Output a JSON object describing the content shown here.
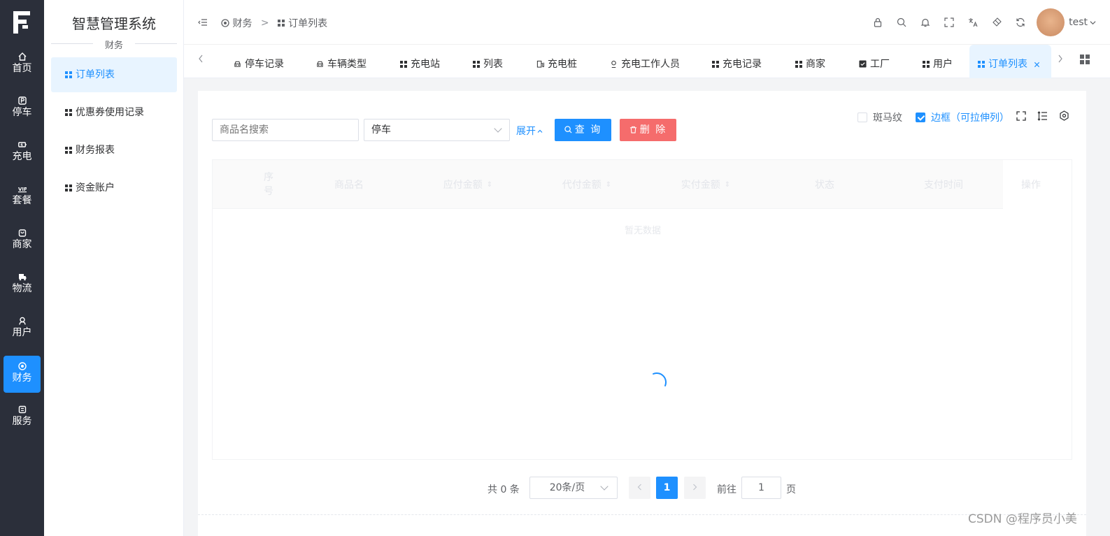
{
  "rail": {
    "items": [
      {
        "label": "首页",
        "icon": "home-icon"
      },
      {
        "label": "停车",
        "icon": "parking-icon"
      },
      {
        "label": "充电",
        "icon": "battery-icon"
      },
      {
        "label": "套餐",
        "icon": "vip-icon"
      },
      {
        "label": "商家",
        "icon": "shop-icon"
      },
      {
        "label": "物流",
        "icon": "truck-icon"
      },
      {
        "label": "用户",
        "icon": "user-icon"
      },
      {
        "label": "财务",
        "icon": "finance-icon",
        "active": true
      },
      {
        "label": "服务",
        "icon": "service-icon"
      }
    ]
  },
  "submenu": {
    "title": "智慧管理系统",
    "group": "财务",
    "items": [
      {
        "label": "订单列表",
        "active": true
      },
      {
        "label": "优惠券使用记录"
      },
      {
        "label": "财务报表"
      },
      {
        "label": "资金账户"
      }
    ]
  },
  "header": {
    "breadcrumb": [
      "财务",
      ">",
      "订单列表"
    ],
    "user": "test"
  },
  "tabs": [
    {
      "label": "停车记录",
      "icon": "car-icon"
    },
    {
      "label": "车辆类型",
      "icon": "car-icon"
    },
    {
      "label": "充电站",
      "icon": "grid-icon"
    },
    {
      "label": "列表",
      "icon": "grid-icon"
    },
    {
      "label": "充电桩",
      "icon": "charger-icon"
    },
    {
      "label": "充电工作人员",
      "icon": "worker-icon"
    },
    {
      "label": "充电记录",
      "icon": "grid-icon"
    },
    {
      "label": "商家",
      "icon": "grid-icon"
    },
    {
      "label": "工厂",
      "icon": "factory-icon"
    },
    {
      "label": "用户",
      "icon": "grid-icon"
    },
    {
      "label": "订单列表",
      "icon": "grid-icon",
      "active": true
    }
  ],
  "filters": {
    "search_placeholder": "商品名搜索",
    "category": "停车",
    "expand": "展开",
    "query": "查 询",
    "delete": "删 除"
  },
  "table_options": {
    "stripe": "斑马纹",
    "border": "边框（可拉伸列）"
  },
  "table": {
    "columns": [
      "序号",
      "商品名",
      "应付金额",
      "代付金额",
      "实付金额",
      "状态",
      "支付时间",
      "操作"
    ],
    "empty_text": "暂无数据"
  },
  "pagination": {
    "total_label": "共 0 条",
    "page_size": "20条/页",
    "current_page": "1",
    "goto_label": "前往",
    "goto_value": "1",
    "page_unit": "页"
  },
  "watermark": "CSDN @程序员小美",
  "colors": {
    "primary": "#1e90ff",
    "danger": "#f56c6c",
    "rail_bg": "#2b2f3a"
  }
}
